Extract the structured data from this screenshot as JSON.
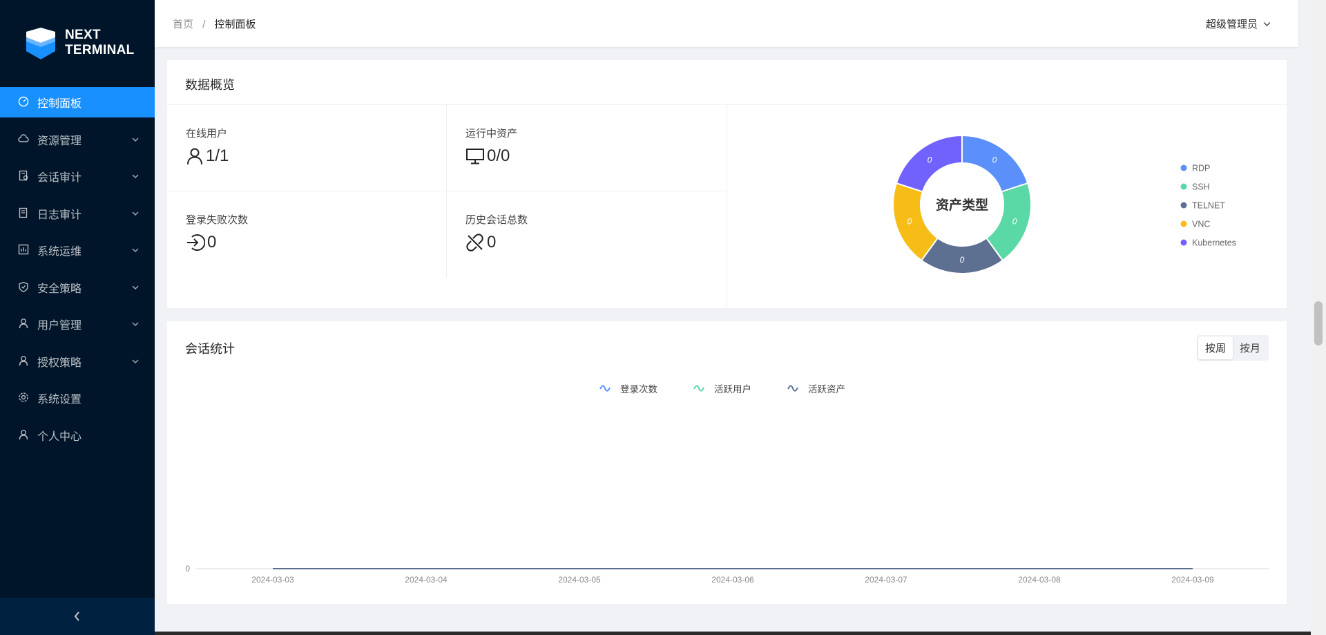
{
  "app": {
    "logo_line1": "NEXT",
    "logo_line2": "TERMINAL"
  },
  "sidebar": {
    "items": [
      {
        "label": "控制面板",
        "icon": "dashboard-icon",
        "active": true,
        "expandable": false
      },
      {
        "label": "资源管理",
        "icon": "cloud-icon",
        "active": false,
        "expandable": true
      },
      {
        "label": "会话审计",
        "icon": "audit-icon",
        "active": false,
        "expandable": true
      },
      {
        "label": "日志审计",
        "icon": "log-icon",
        "active": false,
        "expandable": true
      },
      {
        "label": "系统运维",
        "icon": "chart-icon",
        "active": false,
        "expandable": true
      },
      {
        "label": "安全策略",
        "icon": "shield-icon",
        "active": false,
        "expandable": true
      },
      {
        "label": "用户管理",
        "icon": "user-icon",
        "active": false,
        "expandable": true
      },
      {
        "label": "授权策略",
        "icon": "user-icon",
        "active": false,
        "expandable": true
      },
      {
        "label": "系统设置",
        "icon": "gear-icon",
        "active": false,
        "expandable": false
      },
      {
        "label": "个人中心",
        "icon": "user-icon",
        "active": false,
        "expandable": false
      }
    ]
  },
  "header": {
    "breadcrumb": [
      "首页",
      "控制面板"
    ],
    "breadcrumb_sep": "/",
    "user": "超级管理员"
  },
  "overview": {
    "title": "数据概览",
    "stats": [
      {
        "label": "在线用户",
        "value": "1/1",
        "icon": "user-icon"
      },
      {
        "label": "运行中资产",
        "value": "0/0",
        "icon": "desktop-icon"
      },
      {
        "label": "登录失败次数",
        "value": "0",
        "icon": "login-icon"
      },
      {
        "label": "历史会话总数",
        "value": "0",
        "icon": "disconnect-icon"
      }
    ]
  },
  "sessions": {
    "title": "会话统计",
    "toggle": {
      "week": "按周",
      "month": "按月",
      "selected": "week"
    }
  },
  "chart_data": [
    {
      "type": "pie",
      "title": "资产类型",
      "donut": true,
      "categories": [
        "RDP",
        "SSH",
        "TELNET",
        "VNC",
        "Kubernetes"
      ],
      "values": [
        0,
        0,
        0,
        0,
        0
      ],
      "colors": [
        "#5b8ff9",
        "#5ad8a6",
        "#5d7092",
        "#f6bd16",
        "#7262fd"
      ],
      "legend": "right"
    },
    {
      "type": "line",
      "x": [
        "2024-03-03",
        "2024-03-04",
        "2024-03-05",
        "2024-03-06",
        "2024-03-07",
        "2024-03-08",
        "2024-03-09"
      ],
      "series": [
        {
          "name": "登录次数",
          "color": "#5b8ff9",
          "values": [
            0,
            0,
            0,
            0,
            0,
            0,
            0
          ]
        },
        {
          "name": "活跃用户",
          "color": "#5ad8a6",
          "values": [
            0,
            0,
            0,
            0,
            0,
            0,
            0
          ]
        },
        {
          "name": "活跃资产",
          "color": "#5d7092",
          "values": [
            0,
            0,
            0,
            0,
            0,
            0,
            0
          ]
        }
      ],
      "y_ticks": [
        "0"
      ],
      "legend": "top"
    }
  ]
}
